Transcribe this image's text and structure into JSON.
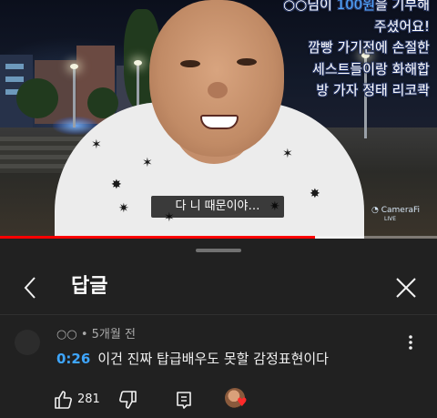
{
  "video": {
    "donation_lines": [
      "○○님이 100원을 기부해",
      "주셨어요!",
      "깜빵 가기전에 손절한",
      "세스트들이랑 화해합",
      "방 가자 정태 리코콱"
    ],
    "donation_amount": "100원",
    "caption": "다 니 때문이야…",
    "watermark": "CameraFi",
    "watermark_sub": "LIVE",
    "progress": 0.72
  },
  "sheet": {
    "title": "답글",
    "back_icon": "chevron-left-icon",
    "close_icon": "close-icon"
  },
  "comment": {
    "author": "○○",
    "separator": "•",
    "age": "5개월 전",
    "timestamp": "0:26",
    "text": "이건 진짜 탑급배우도 못할 감정표현이다",
    "like_count": "281"
  },
  "colors": {
    "background": "#212121",
    "text": "#f1f1f1",
    "meta": "#aaaaaa",
    "timestamp": "#3ea6ff",
    "progress": "#ff0000",
    "heart": "#ff2a2a"
  }
}
